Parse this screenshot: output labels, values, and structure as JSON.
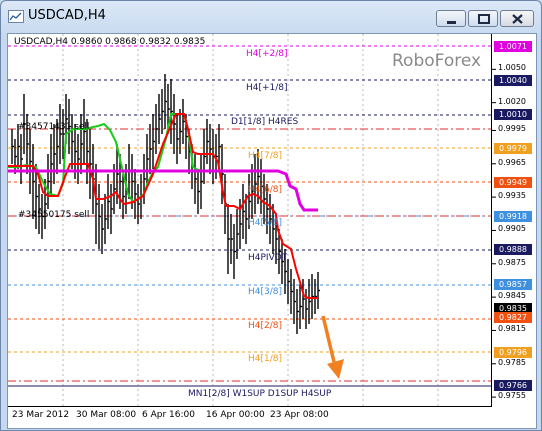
{
  "window": {
    "title": "USDCAD,H4"
  },
  "chart_info": "USDCAD,H4  0.9860 0.9868 0.9832 0.9835",
  "brand": "RoboForex",
  "colors": {
    "candles": "#000000",
    "green_ma": "#18cc18",
    "red_ma": "#ff0000",
    "magenta_ma": "#e000e0",
    "arrow": "#f08020"
  },
  "levels": {
    "h4_p28": "H4[+2/8]",
    "h4_p18": "H4[+1/8]",
    "d1_h4res": "D1[1/8] H4RES",
    "h4_78": "H4[7/8]",
    "h4_68": "H4[6/8]",
    "h4_58": "H4[5/8]",
    "h4pivot": "H4PIVOT",
    "h4_38": "H4[3/8]",
    "h4_28": "H4[2/8]",
    "h4_18": "H4[1/8]",
    "bottom": "MN1[2/8] W1SUP D1SUP H4SUP"
  },
  "orders": {
    "sell1": "#34571431 sell",
    "sell2": "#34550175 sell"
  },
  "y_axis": {
    "ticks": [
      "1.0050",
      "1.0020",
      "0.9995",
      "0.9965",
      "0.9935",
      "0.9905",
      "0.9875",
      "0.9845",
      "0.9815",
      "0.9785",
      "0.9755"
    ],
    "boxes": [
      {
        "label": "1.0071",
        "color": "#e000e0"
      },
      {
        "label": "1.0040",
        "color": "#1a1a60"
      },
      {
        "label": "1.0010",
        "color": "#1a1a60"
      },
      {
        "label": "0.9979",
        "color": "#f0a020"
      },
      {
        "label": "0.9949",
        "color": "#f05010"
      },
      {
        "label": "0.9918",
        "color": "#4090e0"
      },
      {
        "label": "0.9888",
        "color": "#1a1a60"
      },
      {
        "label": "0.9857",
        "color": "#4090e0"
      },
      {
        "label": "0.9835",
        "color": "#000000"
      },
      {
        "label": "0.9827",
        "color": "#f05010"
      },
      {
        "label": "0.9796",
        "color": "#f0a020"
      },
      {
        "label": "0.9766",
        "color": "#1a1a60"
      }
    ]
  },
  "x_axis": {
    "ticks": [
      "23 Mar 2012",
      "30 Mar 08:00",
      "6 Apr 16:00",
      "16 Apr 00:00",
      "23 Apr 08:00"
    ]
  }
}
